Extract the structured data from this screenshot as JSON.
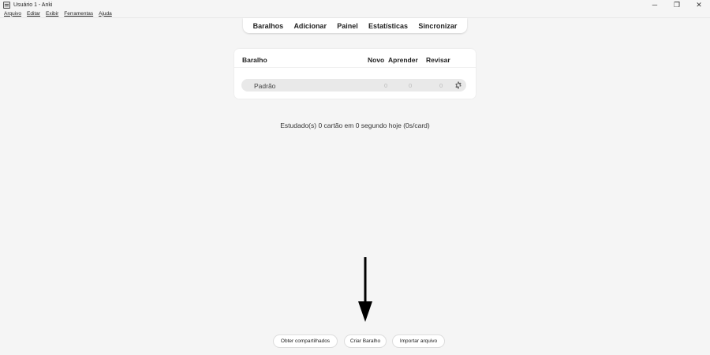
{
  "window": {
    "title": "Usuário 1 - Anki",
    "icon": "anki-app-icon",
    "controls": {
      "minimize": "─",
      "maximize": "❐",
      "close": "✕"
    }
  },
  "menubar": {
    "items": [
      {
        "label": "Arquivo"
      },
      {
        "label": "Editar"
      },
      {
        "label": "Exibir"
      },
      {
        "label": "Ferramentas"
      },
      {
        "label": "Ajuda"
      }
    ]
  },
  "toolbar": {
    "items": [
      {
        "label": "Baralhos"
      },
      {
        "label": "Adicionar"
      },
      {
        "label": "Painel"
      },
      {
        "label": "Estatísticas"
      },
      {
        "label": "Sincronizar"
      }
    ]
  },
  "decks": {
    "headers": {
      "deck": "Baralho",
      "new": "Novo",
      "learn": "Aprender",
      "review": "Revisar"
    },
    "rows": [
      {
        "name": "Padrão",
        "new": "0",
        "learn": "0",
        "review": "0",
        "options_icon": "gear-icon"
      }
    ]
  },
  "stats": {
    "text": "Estudado(s) 0 cartão em 0 segundo hoje (0s/card)"
  },
  "annotation": {
    "icon": "down-arrow-icon",
    "color": "#000000"
  },
  "bottom_buttons": {
    "shared": "Obter compartilhados",
    "create": "Criar Baralho",
    "import": "Importar arquivo"
  }
}
